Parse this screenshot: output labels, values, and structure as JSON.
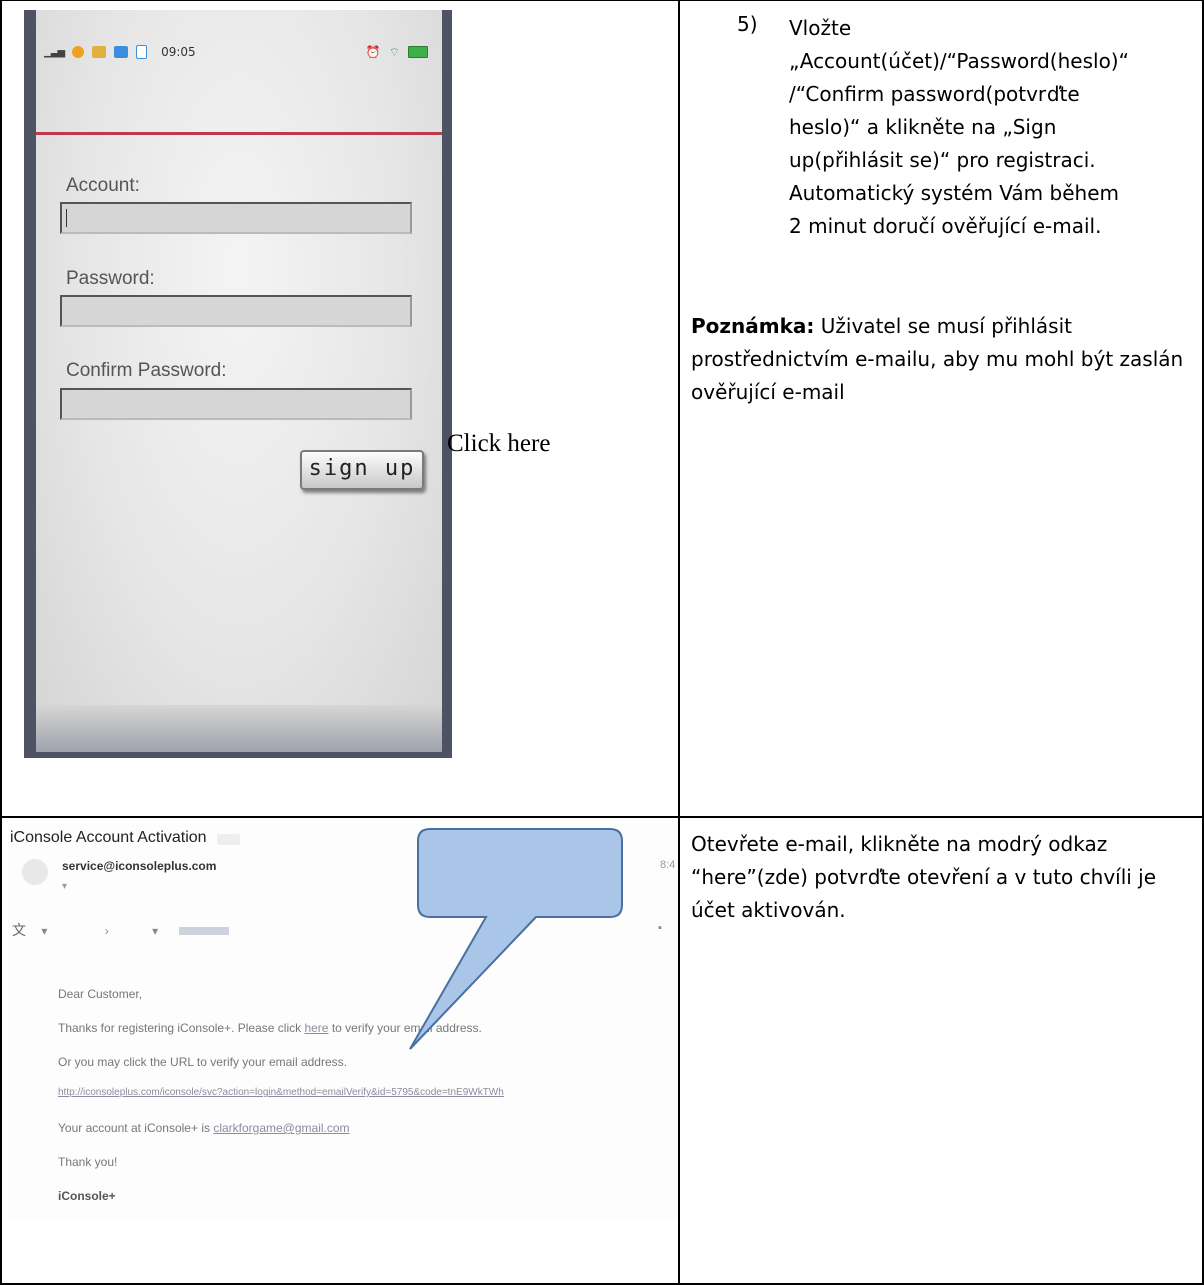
{
  "phone": {
    "status_time": "09:05",
    "account_label": "Account:",
    "password_label": "Password:",
    "confirm_label": "Confirm Password:",
    "signup_label": "sign up"
  },
  "annotation": {
    "click_here": "Click here"
  },
  "step": {
    "number": "5)",
    "text": "Vložte\n„Account(účet)/“Password(heslo)“\n/“Confirm password(potvrďte\nheslo)“ a klikněte na „Sign\nup(přihlásit se)“ pro registraci.\nAutomatický systém Vám během\n2 minut doručí ověřující e-mail."
  },
  "note": {
    "label": "Poznámka:",
    "text": " Uživatel se musí přihlásit prostřednictvím e-mailu, aby mu mohl být zaslán ověřující e-mail"
  },
  "email": {
    "subject": "iConsole Account Activation",
    "sender": "service@iconsoleplus.com",
    "greeting": "Dear Customer,",
    "line1_before": "Thanks for registering iConsole+. Please click ",
    "line1_link": "here",
    "line1_after": " to verify your email address.",
    "line2": "Or you may click the URL to verify your email address.",
    "url": "http://iconsoleplus.com/iconsole/svc?action=login&method=emailVerify&id=5795&code=tnE9WkTWh",
    "account_before": "Your account at iConsole+ is ",
    "account_email": "clarkforgame@gmail.com",
    "thanks": "Thank you!",
    "signature": "iConsole+"
  },
  "email_instruction": "Otevřete e-mail, klikněte na modrý odkaz “here”(zde) potvrďte otevření a v tuto chvíli je účet aktivován.",
  "colors": {
    "callout_fill": "#a9c5e8",
    "callout_stroke": "#4a6fa0",
    "divider_red": "#c0394a",
    "phone_frame": "#4d5362"
  }
}
